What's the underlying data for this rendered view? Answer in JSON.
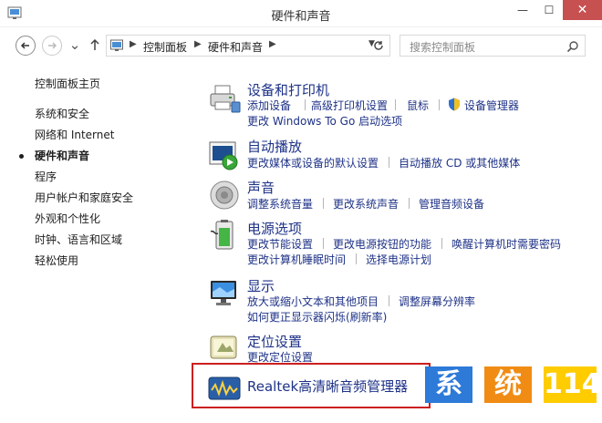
{
  "window": {
    "title": "硬件和声音",
    "min_label": "—",
    "max_label": "☐",
    "close_label": "✕"
  },
  "nav": {
    "up_dir": "⌄",
    "address": {
      "crumbs": [
        "控制面板",
        "硬件和声音"
      ]
    },
    "search_placeholder": "搜索控制面板"
  },
  "sidebar": {
    "items": [
      {
        "label": "控制面板主页"
      },
      {
        "label": "系统和安全"
      },
      {
        "label": "网络和 Internet"
      },
      {
        "label": "硬件和声音",
        "active": true
      },
      {
        "label": "程序"
      },
      {
        "label": "用户帐户和家庭安全"
      },
      {
        "label": "外观和个性化"
      },
      {
        "label": "时钟、语言和区域"
      },
      {
        "label": "轻松使用"
      }
    ]
  },
  "categories": {
    "devices": {
      "title": "设备和打印机",
      "links": [
        "添加设备",
        "高级打印机设置",
        "鼠标",
        "设备管理器",
        "更改 Windows To Go 启动选项"
      ]
    },
    "autoplay": {
      "title": "自动播放",
      "links": [
        "更改媒体或设备的默认设置",
        "自动播放 CD 或其他媒体"
      ]
    },
    "sound": {
      "title": "声音",
      "links": [
        "调整系统音量",
        "更改系统声音",
        "管理音频设备"
      ]
    },
    "power": {
      "title": "电源选项",
      "links": [
        "更改节能设置",
        "更改电源按钮的功能",
        "唤醒计算机时需要密码",
        "更改计算机睡眠时间",
        "选择电源计划"
      ]
    },
    "display": {
      "title": "显示",
      "links": [
        "放大或缩小文本和其他项目",
        "调整屏幕分辨率",
        "如何更正显示器闪烁(刷新率)"
      ]
    },
    "location": {
      "title": "定位设置",
      "links": [
        "更改定位设置"
      ]
    },
    "realtek": {
      "title": "Realtek高清晰音频管理器"
    }
  },
  "watermark": [
    "系",
    "统",
    "114"
  ],
  "colors": {
    "link": "#1e3287",
    "highlight_border": "#cc1f1f",
    "watermark_blue": "#2d7ad8",
    "watermark_orange": "#f08c14",
    "watermark_yellow": "#ffcc00"
  }
}
